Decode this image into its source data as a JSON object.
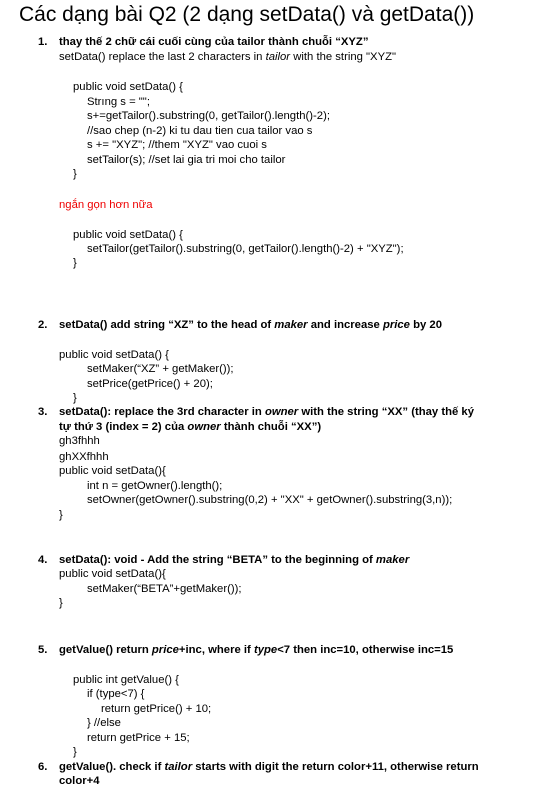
{
  "title": "Các dạng bài Q2 (2 dạng setData() và getData())",
  "s1": {
    "num": "1.",
    "pre": "thay thế 2 chữ cái cuối cùng của tailor thành chuỗi “XYZ”",
    "desc_a": "setData() replace the last 2 characters in ",
    "desc_em": "tailor",
    "desc_b": " with the string \"XYZ\"",
    "code1": [
      "public void setData() {",
      "Strıng s = \"\";",
      "s+=getTailor().substring(0, getTailor().length()-2);",
      "//sao chep (n-2) ki tu dau tien cua tailor vao s",
      "s += \"XYZ\"; //them \"XYZ\" vao cuoi s",
      "setTailor(s); //set lai gia tri moi cho tailor",
      "}"
    ],
    "note": "ngắn gọn hơn nữa",
    "code2": [
      "public void setData() {",
      "setTailor(getTailor().substring(0, getTailor().length()-2) + \"XYZ\");",
      "}"
    ]
  },
  "s2": {
    "num": "2.",
    "h_a": "setData() add string “XZ” to the head of ",
    "h_em1": "maker",
    "h_b": " and increase ",
    "h_em2": "price",
    "h_c": " by 20",
    "code": [
      "public void setData() {",
      "setMaker(“XZ” + getMaker());",
      "setPrice(getPrice() + 20);",
      "}"
    ]
  },
  "s3": {
    "num": "3.",
    "h1_a": "setData(): replace the 3rd character in ",
    "h1_em": "owner",
    "h1_b": " with the string “XX” (thay thế ký",
    "h2_a": "tự thứ 3 (index = 2) của ",
    "h2_em": "owner",
    "h2_b": " thành chuỗi “XX”)",
    "ex1": "gh3fhhh",
    "ex2": "ghXXfhhh",
    "code": [
      "public void setData(){",
      "int n = getOwner().length();",
      "setOwner(getOwner().substring(0,2) + \"XX\" + getOwner().substring(3,n));",
      "}"
    ]
  },
  "s4": {
    "num": "4.",
    "h_a": "setData(): void - Add the string “BETA” to the beginning of ",
    "h_em": "maker",
    "code": [
      "public void setData(){",
      "setMaker(“BETA”+getMaker());",
      "}"
    ]
  },
  "s5": {
    "num": "5.",
    "h_a": "getValue() return ",
    "h_em1": "price",
    "h_b": "+inc, where if ",
    "h_em2": "type",
    "h_c": "<7 then inc=10, otherwise inc=15",
    "code": [
      "public int getValue() {",
      "if (type<7) {",
      "return getPrice() + 10;",
      "} //else",
      "return getPrice + 15;",
      "}"
    ]
  },
  "s6": {
    "num": "6.",
    "h1_a": "getValue(). check if ",
    "h1_em": "tailor",
    "h1_b": " starts with digit the return color+11, otherwise return",
    "h2": "color+4"
  }
}
